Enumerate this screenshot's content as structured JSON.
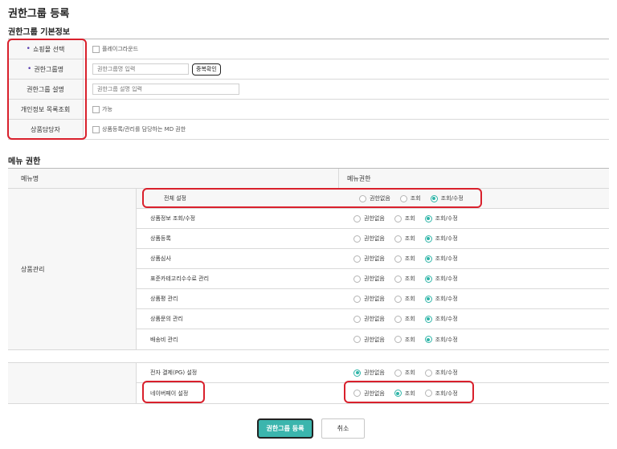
{
  "page_title": "권한그룹 등록",
  "basic_section_title": "권한그룹 기본정보",
  "basic_rows": [
    {
      "label": "쇼핑몰 선택",
      "required": "•",
      "checkbox_label": "플레이그라운드"
    },
    {
      "label": "권한그룹명",
      "required": "•",
      "input_placeholder": "권한그룹명 입력",
      "button_label": "중복확인"
    },
    {
      "label": "권한그룹 설명",
      "input_placeholder": "권한그룹 설명 입력"
    },
    {
      "label": "개인정보 목록조회",
      "checkbox_label": "가능"
    },
    {
      "label": "상품담당자",
      "checkbox_label": "상품등록/관리를 담당하는 MD 권한"
    }
  ],
  "menu_section_title": "메뉴 권한",
  "menu_header": {
    "name": "메뉴명",
    "permission": "메뉴권한"
  },
  "radio_options": [
    "권한없음",
    "조회",
    "조회/수정"
  ],
  "group": {
    "label": "상품관리",
    "rows": [
      {
        "name": "전체 설정",
        "selected": "조회/수정"
      },
      {
        "name": "상품정보 조회/수정",
        "selected": "조회/수정"
      },
      {
        "name": "상품등록",
        "selected": "조회/수정"
      },
      {
        "name": "상품심사",
        "selected": "조회/수정"
      },
      {
        "name": "표준카테고리수수료 관리",
        "selected": "조회/수정"
      },
      {
        "name": "상품평 관리",
        "selected": "조회/수정"
      },
      {
        "name": "상품문의 관리",
        "selected": "조회/수정"
      },
      {
        "name": "배송비 관리",
        "selected": "조회/수정"
      }
    ]
  },
  "group2": {
    "rows": [
      {
        "name": "전자 결제(PG) 설정",
        "selected": "권한없음"
      },
      {
        "name": "네이버페이 설정",
        "selected": "조회"
      }
    ]
  },
  "buttons": {
    "submit": "권한그룹 등록",
    "cancel": "취소"
  },
  "colors": {
    "accent": "#3bb5ad",
    "annotation": "#d9202c",
    "required": "#5a3fb0"
  }
}
